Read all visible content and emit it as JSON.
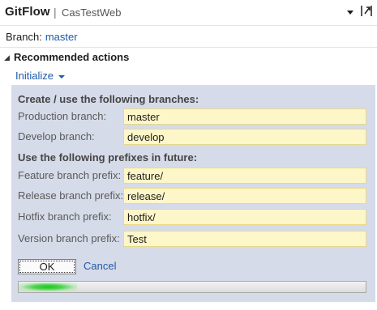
{
  "header": {
    "title": "GitFlow",
    "separator": "|",
    "repo": "CasTestWeb"
  },
  "branch": {
    "label": "Branch:",
    "value": "master"
  },
  "recommended": {
    "heading": "Recommended actions",
    "action_label": "Initialize"
  },
  "form": {
    "branches_heading": "Create / use the following branches:",
    "prefixes_heading": "Use the following prefixes in future:",
    "fields": [
      {
        "label": "Production branch:",
        "value": "master"
      },
      {
        "label": "Develop branch:",
        "value": "develop"
      },
      {
        "label": "Feature branch prefix:",
        "value": "feature/"
      },
      {
        "label": "Release branch prefix:",
        "value": "release/"
      },
      {
        "label": "Hotfix branch prefix:",
        "value": "hotfix/"
      },
      {
        "label": "Version branch prefix:",
        "value": "Test"
      }
    ],
    "ok_label": "OK",
    "cancel_label": "Cancel",
    "progress": {
      "indeterminate": true,
      "color": "#1fc41f"
    }
  },
  "colors": {
    "link": "#1e5aa8",
    "panel_bg": "#d6dbe9",
    "input_bg": "#fdf6c8"
  },
  "icons": {
    "header_dropdown": "dropdown-arrow-icon",
    "header_nav": "navigate-up-icon",
    "section_toggle": "collapse-triangle-icon",
    "initialize_caret": "chevron-down-icon"
  }
}
